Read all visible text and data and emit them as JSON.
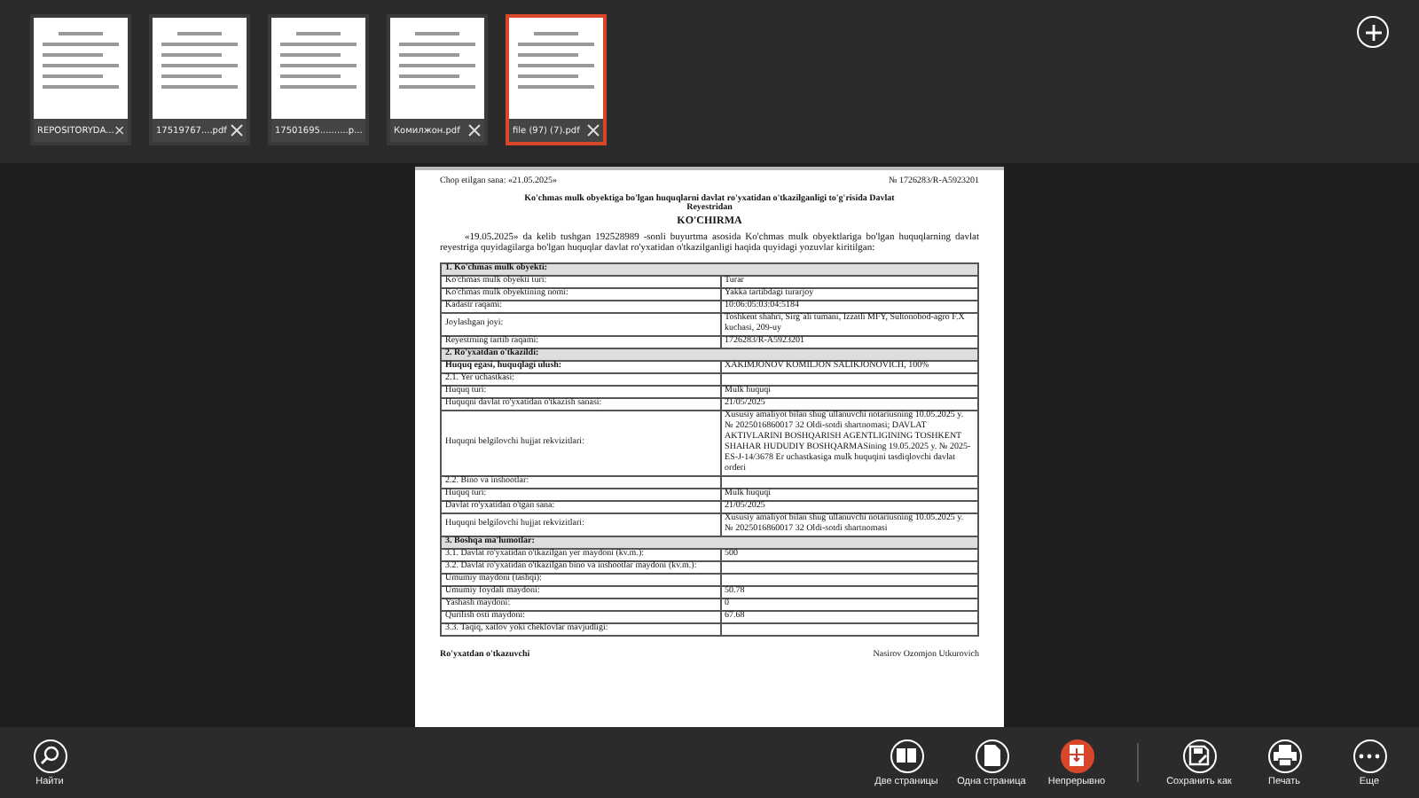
{
  "tabs": [
    {
      "label": "REPOSITORYDA...",
      "selected": false
    },
    {
      "label": "17519767....pdf",
      "selected": false
    },
    {
      "label": "17501695..........p...",
      "selected": false
    },
    {
      "label": "Комилжон.pdf",
      "selected": false
    },
    {
      "label": "file (97) (7).pdf",
      "selected": true
    }
  ],
  "document": {
    "print_date": "Chop etilgan sana: «21.05.2025»",
    "number": "№ 1726283/R-A5923201",
    "title": "Ko'chmas mulk obyektiga bo'lgan huquqlarni davlat ro'yxatidan o'tkazilganligi to'g'risida Davlat Reyestridan",
    "subtitle": "KO'CHIRMA",
    "intro": "«19.05.2025» da kelib tushgan 192528989 -sonli buyurtma asosida Ko'chmas mulk obyektlariga bo'lgan huquqlarning davlat reyestriga quyidagilarga bo'lgan huquqlar davlat ro'yxatidan o'tkazilganligi haqida quyidagi yozuvlar kiritilgan:",
    "rows": [
      {
        "kind": "section",
        "label": "1. Ko'chmas mulk obyekti:"
      },
      {
        "kind": "row",
        "label": "Ko'chmas mulk obyekti turi:",
        "value": "Turar"
      },
      {
        "kind": "row",
        "label": "Ko'chmas mulk obyektining nomi:",
        "value": "Yakka tartibdagi turarjoy"
      },
      {
        "kind": "row",
        "label": "Kadastr raqami:",
        "value": "10:06:05:03:04:5184"
      },
      {
        "kind": "row",
        "label": "Joylashgan joyi:",
        "value": "Toshkent shahri, Sirg`ali tumani, Izzatli MFY, Sultonobod-agro F.X kuchasi, 209-uy"
      },
      {
        "kind": "row",
        "label": "Reyestrning tartib raqami:",
        "value": "1726283/R-A5923201"
      },
      {
        "kind": "section",
        "label": "2. Ro'yxatdan o'tkazildi:"
      },
      {
        "kind": "bold",
        "label": "Huquq egasi, huquqlagi ulush:",
        "value": "XAKIMJONOV KOMILJON SALIKJONOVICH, 100%"
      },
      {
        "kind": "row",
        "label": "2.1. Yer uchastkasi:",
        "value": ""
      },
      {
        "kind": "row",
        "label": "Huquq turi:",
        "value": "Mulk huquqi"
      },
      {
        "kind": "row",
        "label": "Huquqni davlat ro'yxatidan o'tkazish sanasi:",
        "value": "21/05/2025"
      },
      {
        "kind": "row",
        "label": "Huquqni belgilovchi hujjat rekvizitlari:",
        "value": "Xususiy amaliyot bilan shug`ullanuvchi notariusning 10.05.2025 y. № 2025016860017 32 Oldi-sotdi shartnomasi; DAVLAT AKTIVLARINI BOSHQARISH AGENTLIGINING TOSHKENT SHAHAR HUDUDIY BOSHQARMASining 19.05.2025 y. № 2025-ES-J-14/3678 Er uchastkasiga mulk huquqini tasdiqlovchi davlat orderi"
      },
      {
        "kind": "row",
        "label": "2.2. Bino va inshootlar:",
        "value": ""
      },
      {
        "kind": "row",
        "label": "Huquq turi:",
        "value": "Mulk huquqi"
      },
      {
        "kind": "row",
        "label": "Davlat ro'yxatidan o'tgan sana:",
        "value": "21/05/2025"
      },
      {
        "kind": "row",
        "label": "Huquqni belgilovchi hujjat rekvizitlari:",
        "value": "Xususiy amaliyot bilan shug`ullanuvchi notariusning 10.05.2025 y. № 2025016860017 32 Oldi-sotdi shartnomasi"
      },
      {
        "kind": "section",
        "label": "3. Boshqa ma'lumotlar:"
      },
      {
        "kind": "row",
        "label": "3.1. Davlat ro'yxatidan o'tkazilgan yer maydoni (kv.m.):",
        "value": "500"
      },
      {
        "kind": "row",
        "label": "3.2. Davlat ro'yxatidan o'tkazilgan bino va inshootlar maydoni (kv.m.):",
        "value": ""
      },
      {
        "kind": "row",
        "label": "Umumiy maydoni (tashqi):",
        "value": ""
      },
      {
        "kind": "row",
        "label": "Umumiy foydali maydoni:",
        "value": "50.78"
      },
      {
        "kind": "row",
        "label": "Yashash maydoni:",
        "value": "0"
      },
      {
        "kind": "row",
        "label": "Qurilish osti maydoni:",
        "value": "67.68"
      },
      {
        "kind": "row",
        "label": "3.3. Taqiq, xatlov yoki cheklovlar mavjudligi:",
        "value": ""
      }
    ],
    "signer_role": "Ro'yxatdan o'tkazuvchi",
    "signer_name": "Nasirov Ozomjon Utkurovich"
  },
  "toolbar": {
    "left": [
      {
        "label": "Найти",
        "selected": false
      }
    ],
    "right": [
      {
        "label": "Две страницы",
        "selected": false
      },
      {
        "label": "Одна страница",
        "selected": false
      },
      {
        "label": "Непрерывно",
        "selected": true
      },
      {
        "label": "Сохранить как",
        "selected": false
      },
      {
        "label": "Печать",
        "selected": false
      },
      {
        "label": "Еще",
        "selected": false
      }
    ]
  }
}
